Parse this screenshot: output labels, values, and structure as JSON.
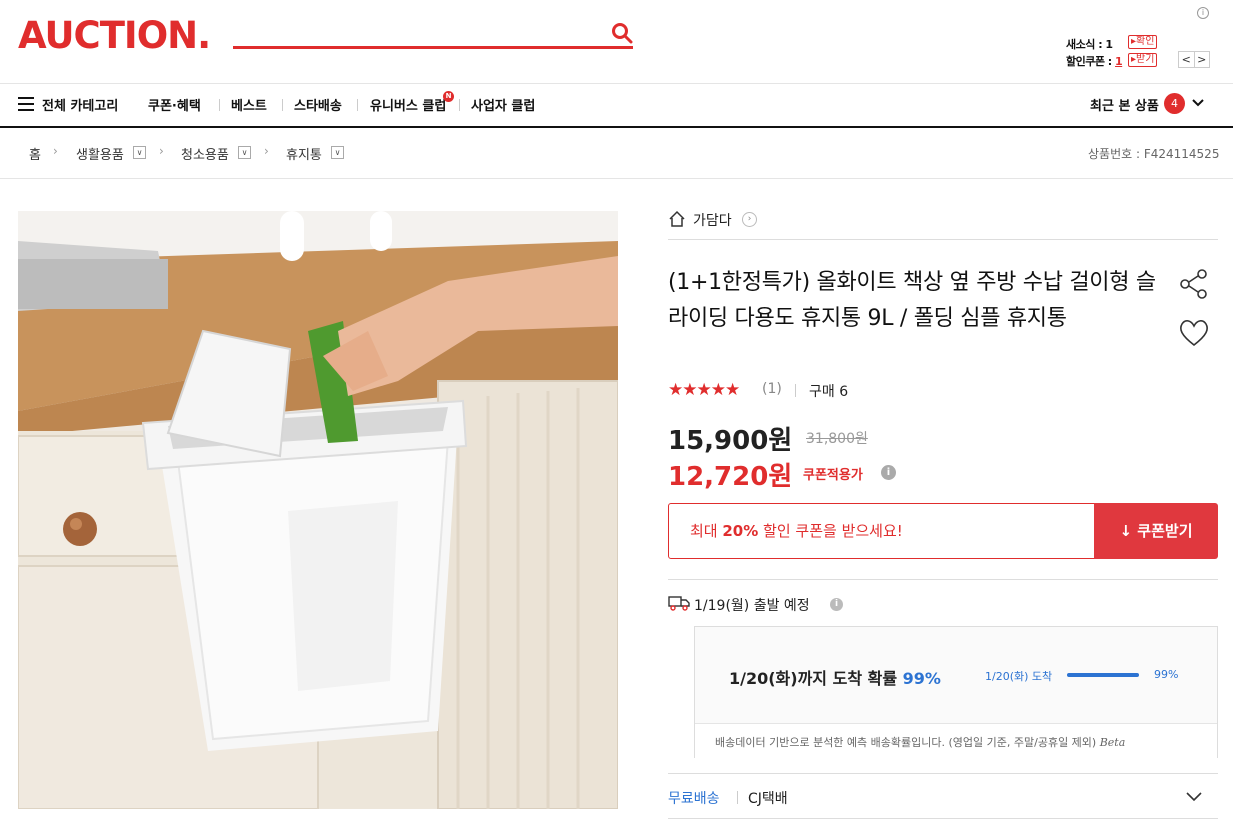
{
  "header": {
    "logo": "AUCTION.",
    "my_news_label": "새소식 : ",
    "my_news_count": "1",
    "my_coupon_label": "할인쿠폰 : ",
    "my_coupon_count": "1",
    "confirm_btn": "▸확인",
    "receive_btn": "▸받기",
    "prev": "<",
    "next": ">",
    "info": "i"
  },
  "nav": {
    "all_category": "전체 카테고리",
    "items": [
      "쿠폰·혜택",
      "베스트",
      "스타배송",
      "유니버스 클럽",
      "사업자 클럽"
    ],
    "new_badge": "N",
    "recent_label": "최근 본 상품",
    "recent_count": "4"
  },
  "breadcrumb": {
    "home": "홈",
    "level1": "생활용품",
    "level2": "청소용품",
    "level3": "휴지통",
    "product_id": "상품번호 : F424114525"
  },
  "product": {
    "store": "가담다",
    "title": "(1+1한정특가) 올화이트 책상 옆 주방 수납 걸이형 슬라이딩 다용도 휴지통 9L / 폴딩 심플 휴지통",
    "stars": "★★★★★",
    "rating": 5,
    "review_count": "(1)",
    "purchase": "구매 6",
    "price": "15,900원",
    "original_price": "31,800원",
    "coupon_price": "12,720원",
    "coupon_label": "쿠폰적용가",
    "coupon_msg_pre": "최대 ",
    "coupon_msg_pct": "20%",
    "coupon_msg_post": " 할인 쿠폰을 받으세요!",
    "coupon_btn": "↓ 쿠폰받기"
  },
  "shipping": {
    "departure": "1/19(월) 출발 예정",
    "arrival_text": "1/20(화)까지 도착 확률 ",
    "arrival_pct": "99%",
    "bar_label": "1/20(화) 도착",
    "bar_value": 0.99,
    "bar_pct": "99%",
    "note": "배송데이터 기반으로 분석한 예측 배송확률입니다. (영업일 기준, 주말/공휴일 제외) ",
    "beta": "Beta",
    "free_shipping": "무료배송",
    "carrier": "CJ택배"
  },
  "colors": {
    "brand": "#e02d2d",
    "accent_blue": "#2c73d2"
  }
}
